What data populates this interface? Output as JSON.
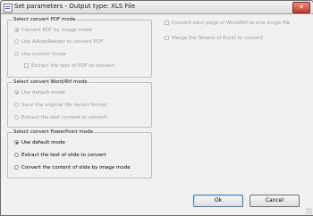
{
  "window": {
    "title": "Set parameters - Output type: XLS File",
    "close_glyph": "✕"
  },
  "pdf_group": {
    "title": "Select convert PDF mode",
    "options": [
      {
        "label": "Convert PDF by image mode",
        "checked": true
      },
      {
        "label": "Use AdobeReader to convert PDF",
        "checked": false
      },
      {
        "label": "Use custom mode",
        "checked": false
      }
    ],
    "sub_checkbox": "Extract the text of PDF to convert"
  },
  "word_group": {
    "title": "Select convert Word/Rtf mode",
    "options": [
      {
        "label": "Use default mode",
        "checked": true
      },
      {
        "label": "Save the original file layout format",
        "checked": false
      },
      {
        "label": "Extract the text content to convert",
        "checked": false
      }
    ]
  },
  "ppt_group": {
    "title": "Select convert PowerPoint mode",
    "options": [
      {
        "label": "Use default mode",
        "checked": true
      },
      {
        "label": "Extract the text of slide to convert",
        "checked": false
      },
      {
        "label": "Convert the content of slide by image mode",
        "checked": false
      }
    ]
  },
  "right_options": {
    "convert_each_page": "Convert each page of Word/Rtf to one single file",
    "merge_sheets": "Merge the Sheets of Excel to convert"
  },
  "buttons": {
    "ok": "Ok",
    "cancel": "Cancel"
  }
}
